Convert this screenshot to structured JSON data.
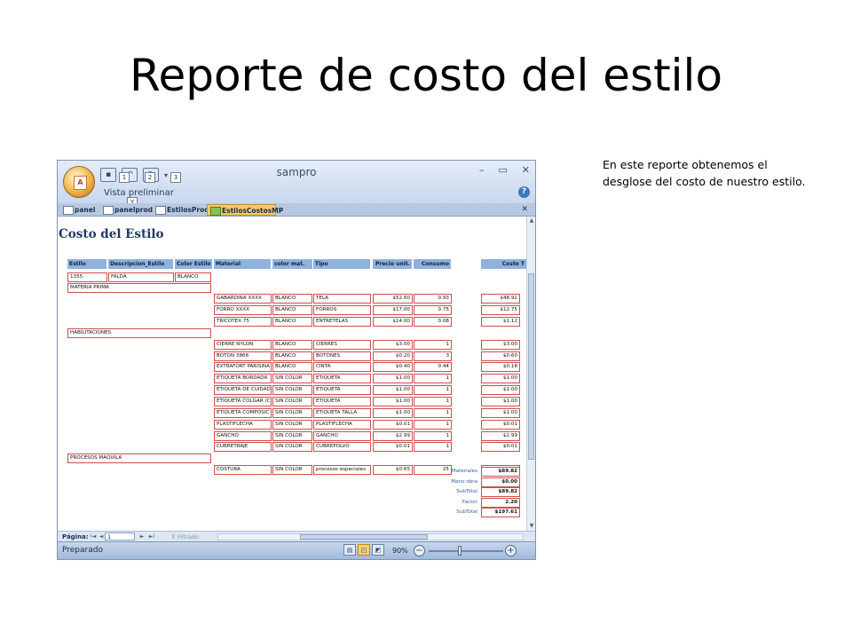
{
  "slide": {
    "title": "Reporte de costo del estilo",
    "note": "En este reporte obtenemos el desglose del costo de nuestro estilo."
  },
  "window": {
    "app_title": "sampro",
    "ribbon_label": "Vista preliminar",
    "qat_keytips": [
      "1",
      "2",
      "3"
    ],
    "ribbon_keytip": "Y",
    "controls": [
      "–",
      "▭",
      "✕"
    ],
    "tab_close": "✕",
    "tabs": [
      {
        "label": "panel",
        "active": false
      },
      {
        "label": "panelprod",
        "active": false
      },
      {
        "label": "EstilosProd",
        "active": false
      },
      {
        "label": "EstilosCostosMP",
        "active": true
      }
    ]
  },
  "report": {
    "title": "Costo del Estilo",
    "headers": {
      "estilo": "Estilo",
      "descripcion": "Descripcion_Estilo",
      "color_estilo": "Color Estilo",
      "material": "Material",
      "color_mat": "color mat.",
      "tipo": "Tipo",
      "precio": "Precio unit.",
      "consumo": "Consumo",
      "costo": "Costo T"
    },
    "style": {
      "estilo": "1355",
      "descripcion": "FALDA",
      "color": "BLANCO"
    },
    "groups": [
      {
        "name": "MATERIA PRIMA",
        "rows": [
          {
            "material": "GABARDINA XXXX",
            "color": "BLANCO",
            "tipo": "TELA",
            "precio": "$52.60",
            "consumo": "0.93",
            "costo": "$48.92"
          },
          {
            "material": "FORRO XXXX",
            "color": "BLANCO",
            "tipo": "FORROS",
            "precio": "$17.00",
            "consumo": "0.75",
            "costo": "$12.75"
          },
          {
            "material": "TRICOTEX 75",
            "color": "BLANCO",
            "tipo": "ENTRETELAS",
            "precio": "$14.00",
            "consumo": "0.08",
            "costo": "$1.12"
          }
        ]
      },
      {
        "name": "HABILITACIONES",
        "rows": [
          {
            "material": "CIERRE NYLON",
            "color": "BLANCO",
            "tipo": "CIERRES",
            "precio": "$3.00",
            "consumo": "1",
            "costo": "$3.00"
          },
          {
            "material": "BOTON 3866",
            "color": "BLANCO",
            "tipo": "BOTONES",
            "precio": "$0.20",
            "consumo": "3",
            "costo": "$0.60"
          },
          {
            "material": "EXTRAFORT PARISINA",
            "color": "BLANCO",
            "tipo": "CINTA",
            "precio": "$0.40",
            "consumo": "0.44",
            "costo": "$0.18"
          },
          {
            "material": "ETIQUETA BORDADA",
            "color": "SIN COLOR",
            "tipo": "ETIQUETA",
            "precio": "$1.00",
            "consumo": "1",
            "costo": "$1.00"
          },
          {
            "material": "ETIQUETA DE CUIDAD",
            "color": "SIN COLOR",
            "tipo": "ETIQUETA",
            "precio": "$1.00",
            "consumo": "1",
            "costo": "$1.00"
          },
          {
            "material": "ETIQUETA COLGAR (C",
            "color": "SIN COLOR",
            "tipo": "ETIQUETA",
            "precio": "$1.00",
            "consumo": "1",
            "costo": "$1.00"
          },
          {
            "material": "ETIQUETA COMPOSIC",
            "color": "SIN COLOR",
            "tipo": "ETIQUETA TALLA",
            "precio": "$1.00",
            "consumo": "1",
            "costo": "$1.00"
          },
          {
            "material": "PLASTIFLECHA",
            "color": "SIN COLOR",
            "tipo": "PLASTIFLECHA",
            "precio": "$0.01",
            "consumo": "1",
            "costo": "$0.01"
          },
          {
            "material": "GANCHO",
            "color": "SIN COLOR",
            "tipo": "GANCHO",
            "precio": "$2.99",
            "consumo": "1",
            "costo": "$2.99"
          },
          {
            "material": "CUBRETRAJE",
            "color": "SIN COLOR",
            "tipo": "CUBREPOLVO",
            "precio": "$0.01",
            "consumo": "1",
            "costo": "$0.01"
          }
        ]
      },
      {
        "name": "PROCESOS MAQUILA",
        "rows": [
          {
            "material": "COSTURA",
            "color": "SIN COLOR",
            "tipo": "procesos especiales",
            "precio": "$0.65",
            "consumo": "25",
            "costo": "$16.25"
          }
        ]
      }
    ],
    "summary": [
      {
        "label": "Materiales",
        "value": "$89.82"
      },
      {
        "label": "Mano obra",
        "value": "$0.00"
      },
      {
        "label": "SubTotal",
        "value": "$89.82"
      },
      {
        "label": "Factor",
        "value": "2.20"
      },
      {
        "label": "SubTotal",
        "value": "$197.61"
      }
    ]
  },
  "navigation": {
    "page_label": "Página:",
    "page_value": "1",
    "filter_label": "Filtrado",
    "buttons": [
      "I◄",
      "◄",
      "►",
      "►I"
    ]
  },
  "status": {
    "text": "Preparado",
    "zoom": "90%"
  }
}
